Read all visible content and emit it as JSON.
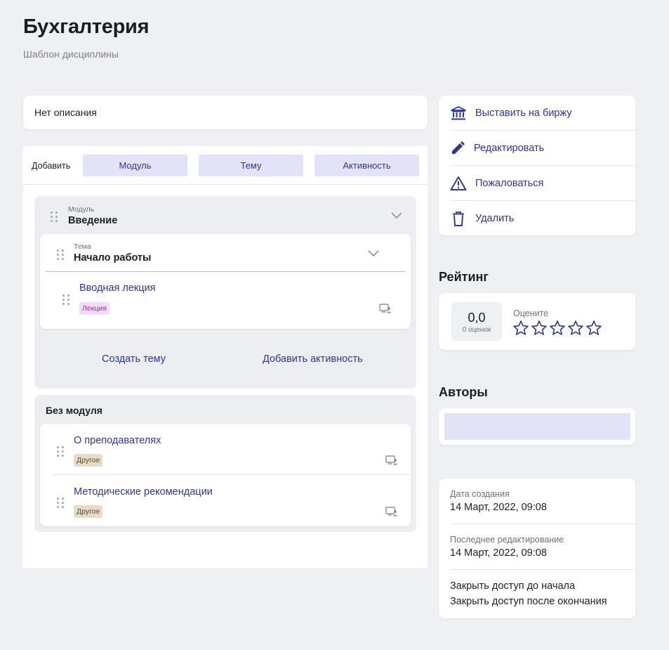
{
  "page": {
    "title": "Бухгалтерия",
    "subtitle": "Шаблон дисциплины"
  },
  "description": "Нет описания",
  "add_bar": {
    "label": "Добавить",
    "buttons": [
      "Модуль",
      "Тему",
      "Активность"
    ]
  },
  "module": {
    "label": "Модуль",
    "name": "Введение",
    "topic": {
      "label": "Тема",
      "name": "Начало работы",
      "activities": [
        {
          "title": "Вводная лекция",
          "badge": "Лекция"
        }
      ]
    },
    "create_topic": "Создать тему",
    "add_activity": "Добавить активность"
  },
  "no_module": {
    "title": "Без модуля",
    "items": [
      {
        "title": "О преподавателях",
        "badge": "Другое"
      },
      {
        "title": "Методические рекомендации",
        "badge": "Другое"
      }
    ]
  },
  "actions": [
    {
      "label": "Выставить на биржу",
      "icon": "bank-icon"
    },
    {
      "label": "Редактировать",
      "icon": "pencil-icon"
    },
    {
      "label": "Пожаловаться",
      "icon": "warning-icon"
    },
    {
      "label": "Удалить",
      "icon": "trash-icon"
    }
  ],
  "rating": {
    "title": "Рейтинг",
    "score": "0,0",
    "count": "0 оценок",
    "rate_label": "Оцените",
    "stars": 0,
    "max_stars": 5
  },
  "authors": {
    "title": "Авторы"
  },
  "meta": {
    "created_label": "Дата создания",
    "created_value": "14 Март, 2022, 09:08",
    "edited_label": "Последнее редактирование",
    "edited_value": "14 Март, 2022, 09:08",
    "access_before": "Закрыть доступ до начала",
    "access_after": "Закрыть доступ после окончания"
  },
  "colors": {
    "accent": "#2d3596",
    "button_bg": "#e3e3f8",
    "page_bg": "#eef0f4",
    "lecture_badge": "#f2dcf6",
    "other_badge": "#e6dcc8"
  }
}
